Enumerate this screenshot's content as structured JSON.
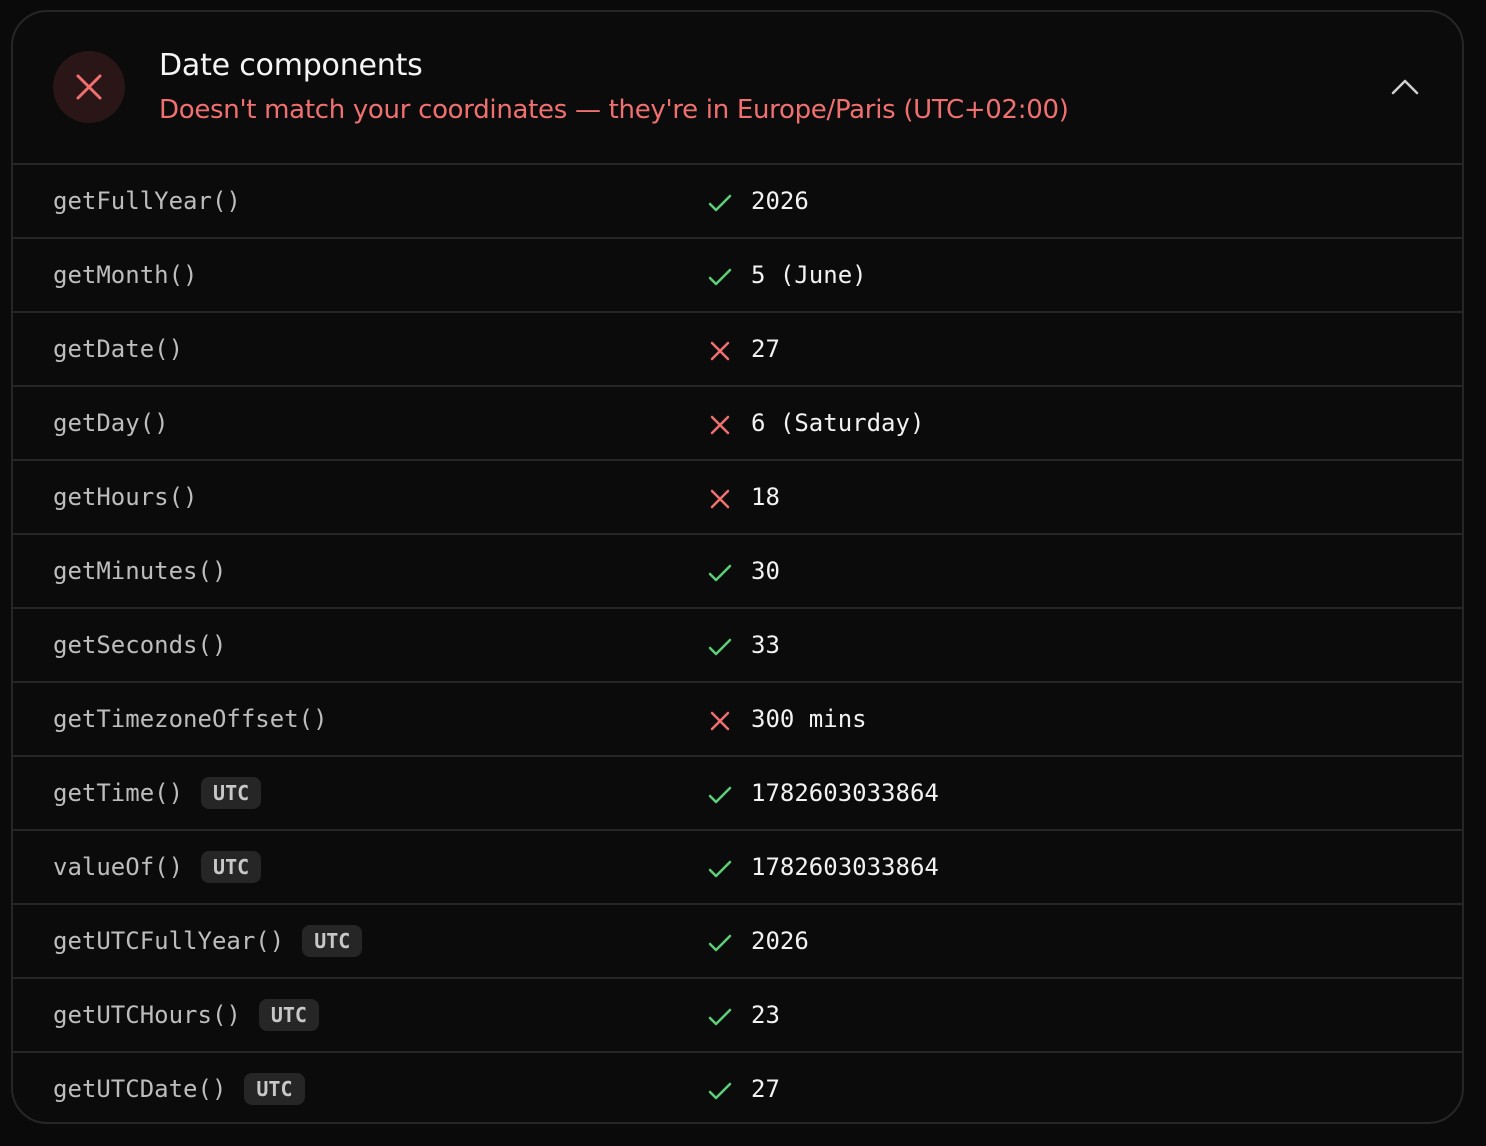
{
  "header": {
    "title": "Date components",
    "subtitle": "Doesn't match your coordinates — they're in Europe/Paris (UTC+02:00)",
    "status_icon": "close-icon",
    "collapse_icon": "chevron-up-icon"
  },
  "colors": {
    "match": "#5ccf7a",
    "mismatch": "#f07070",
    "background": "#0b0b0b",
    "border": "#262626"
  },
  "rows": [
    {
      "method": "getFullYear()",
      "badge": "",
      "status": "match",
      "value": "2026"
    },
    {
      "method": "getMonth()",
      "badge": "",
      "status": "match",
      "value": "5 (June)"
    },
    {
      "method": "getDate()",
      "badge": "",
      "status": "mismatch",
      "value": "27"
    },
    {
      "method": "getDay()",
      "badge": "",
      "status": "mismatch",
      "value": "6 (Saturday)"
    },
    {
      "method": "getHours()",
      "badge": "",
      "status": "mismatch",
      "value": "18"
    },
    {
      "method": "getMinutes()",
      "badge": "",
      "status": "match",
      "value": "30"
    },
    {
      "method": "getSeconds()",
      "badge": "",
      "status": "match",
      "value": "33"
    },
    {
      "method": "getTimezoneOffset()",
      "badge": "",
      "status": "mismatch",
      "value": "300 mins"
    },
    {
      "method": "getTime()",
      "badge": "UTC",
      "status": "match",
      "value": "1782603033864"
    },
    {
      "method": "valueOf()",
      "badge": "UTC",
      "status": "match",
      "value": "1782603033864"
    },
    {
      "method": "getUTCFullYear()",
      "badge": "UTC",
      "status": "match",
      "value": "2026"
    },
    {
      "method": "getUTCHours()",
      "badge": "UTC",
      "status": "match",
      "value": "23"
    },
    {
      "method": "getUTCDate()",
      "badge": "UTC",
      "status": "match",
      "value": "27"
    }
  ]
}
